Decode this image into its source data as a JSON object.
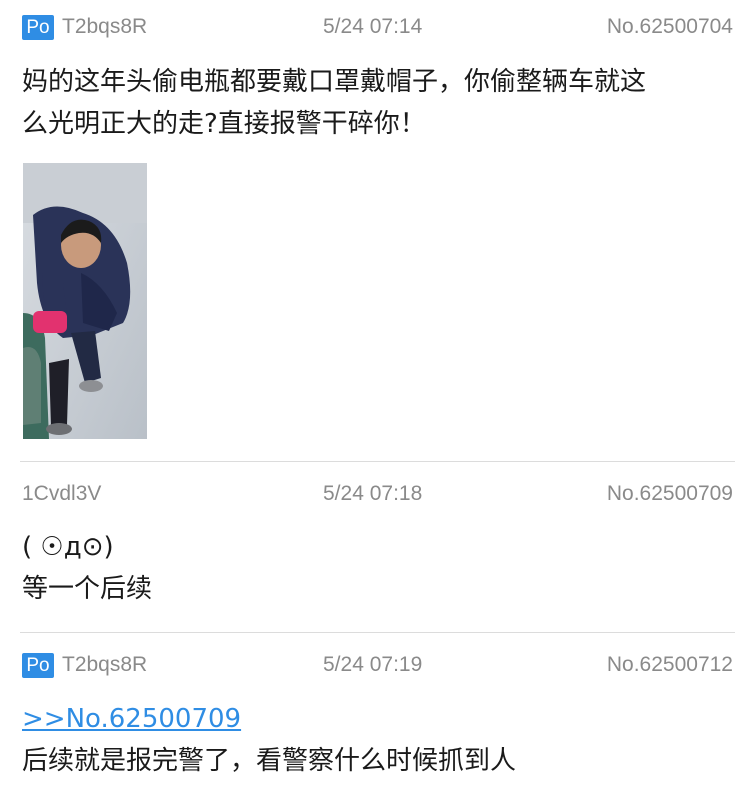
{
  "posts": [
    {
      "is_po": true,
      "po_label": "Po",
      "uid": "T2bqs8R",
      "time": "5/24 07:14",
      "no": "No.62500704",
      "lines": [
        "妈的这年头偷电瓶都要戴口罩戴帽子，你偷整辆车就这",
        "么光明正大的走?直接报警干碎你！"
      ],
      "has_image": true
    },
    {
      "is_po": false,
      "uid": "1Cvdl3V",
      "time": "5/24 07:18",
      "no": "No.62500709",
      "lines": [
        "( ☉д⊙)",
        "等一个后续"
      ]
    },
    {
      "is_po": true,
      "po_label": "Po",
      "uid": "T2bqs8R",
      "time": "5/24 07:19",
      "no": "No.62500712",
      "quote_link": ">>No.62500709",
      "lines": [
        "后续就是报完警了，看警察什么时候抓到人"
      ]
    }
  ],
  "colors": {
    "accent": "#2f8de4",
    "meta_text": "#8a8a8a",
    "divider": "#dcdcdc"
  }
}
